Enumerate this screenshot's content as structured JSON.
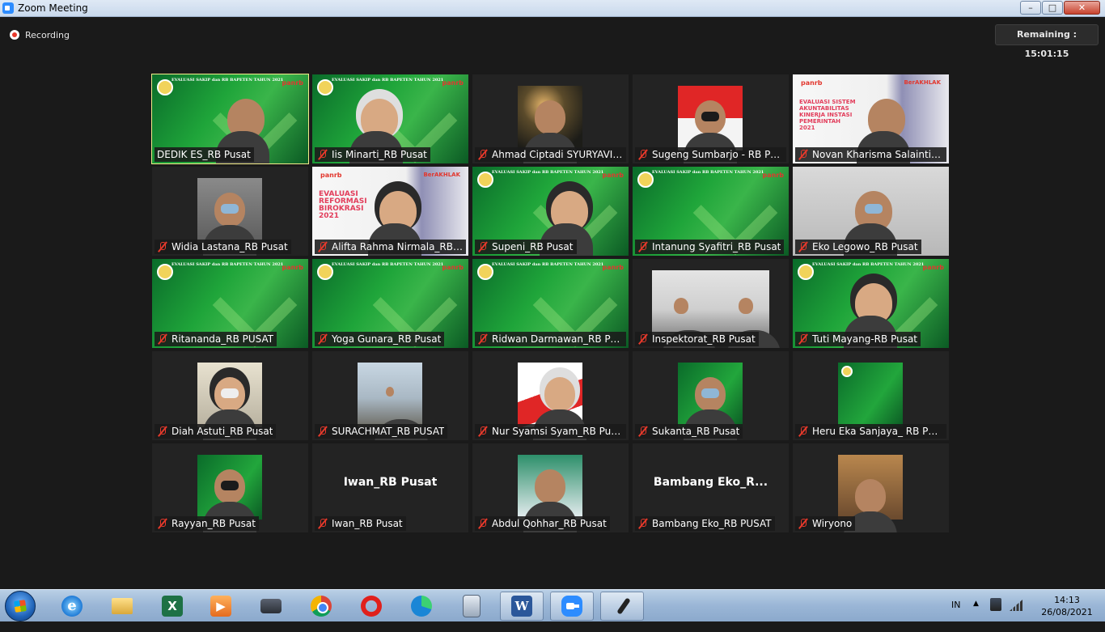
{
  "window": {
    "title": "Zoom Meeting",
    "min_glyph": "–",
    "max_glyph": "□",
    "close_glyph": "✕"
  },
  "status": {
    "recording_label": "Recording",
    "remaining": "Remaining : 15:01:15"
  },
  "tile_text": {
    "slide_title": "EVALUASI SAKIP dan RB BAPETEN TAHUN 2021",
    "panrb": "panrb",
    "berakhlak": "BerAKHLAK",
    "eval_sakip": "EVALUASI SISTEM AKUNTABILITAS KINERJA INSTASI PEMERINTAH 2021",
    "eval_rb": "EVALUASI REFORMASI BIROKRASI 2021"
  },
  "participants": [
    {
      "name": "DEDIK ES_RB Pusat",
      "muted": false
    },
    {
      "name": "Iis Minarti_RB Pusat",
      "muted": true
    },
    {
      "name": "Ahmad Ciptadi SYURYAVIN...",
      "muted": true
    },
    {
      "name": "Sugeng Sumbarjo - RB Pusat",
      "muted": true
    },
    {
      "name": "Novan Kharisma Salainti R...",
      "muted": true
    },
    {
      "name": "Widia Lastana_RB Pusat",
      "muted": true
    },
    {
      "name": "Alifta Rahma Nirmala_RBKu...",
      "muted": true
    },
    {
      "name": "Supeni_RB Pusat",
      "muted": true
    },
    {
      "name": "Intanung Syafitri_RB Pusat",
      "muted": true
    },
    {
      "name": "Eko Legowo_RB Pusat",
      "muted": true
    },
    {
      "name": "Ritananda_RB PUSAT",
      "muted": true
    },
    {
      "name": "Yoga Gunara_RB Pusat",
      "muted": true
    },
    {
      "name": "Ridwan Darmawan_RB Pusat",
      "muted": true
    },
    {
      "name": "Inspektorat_RB Pusat",
      "muted": true
    },
    {
      "name": "Tuti Mayang-RB Pusat",
      "muted": true
    },
    {
      "name": "Diah Astuti_RB Pusat",
      "muted": true
    },
    {
      "name": "SURACHMAT_RB PUSAT",
      "muted": true
    },
    {
      "name": "Nur Syamsi Syam_RB Pusat",
      "muted": true
    },
    {
      "name": "Sukanta_RB Pusat",
      "muted": true
    },
    {
      "name": "Heru Eka Sanjaya_ RB PUSAT",
      "muted": true
    },
    {
      "name": "Rayyan_RB Pusat",
      "muted": true
    },
    {
      "name": "Iwan_RB Pusat",
      "muted": true,
      "video_text": "Iwan_RB Pusat"
    },
    {
      "name": "Abdul Qohhar_RB Pusat",
      "muted": true
    },
    {
      "name": "Bambang Eko_RB PUSAT",
      "muted": true,
      "video_text": "Bambang  Eko_R..."
    },
    {
      "name": "Wiryono",
      "muted": true
    }
  ],
  "taskbar": {
    "apps": [
      {
        "name": "internet-explorer",
        "running": false
      },
      {
        "name": "file-explorer",
        "running": false
      },
      {
        "name": "excel",
        "running": false
      },
      {
        "name": "media-player",
        "running": false
      },
      {
        "name": "laptop-tool",
        "running": false
      },
      {
        "name": "chrome",
        "running": false
      },
      {
        "name": "opera",
        "running": false
      },
      {
        "name": "edge",
        "running": false
      },
      {
        "name": "calculator",
        "running": false
      },
      {
        "name": "word",
        "running": true
      },
      {
        "name": "zoom",
        "running": true
      },
      {
        "name": "microphone-app",
        "running": true
      }
    ],
    "ie_glyph": "e",
    "excel_glyph": "X",
    "word_glyph": "W",
    "media_glyph": "▶",
    "tray": {
      "language": "IN",
      "up_glyph": "▲",
      "time": "14:13",
      "date": "26/08/2021"
    }
  }
}
